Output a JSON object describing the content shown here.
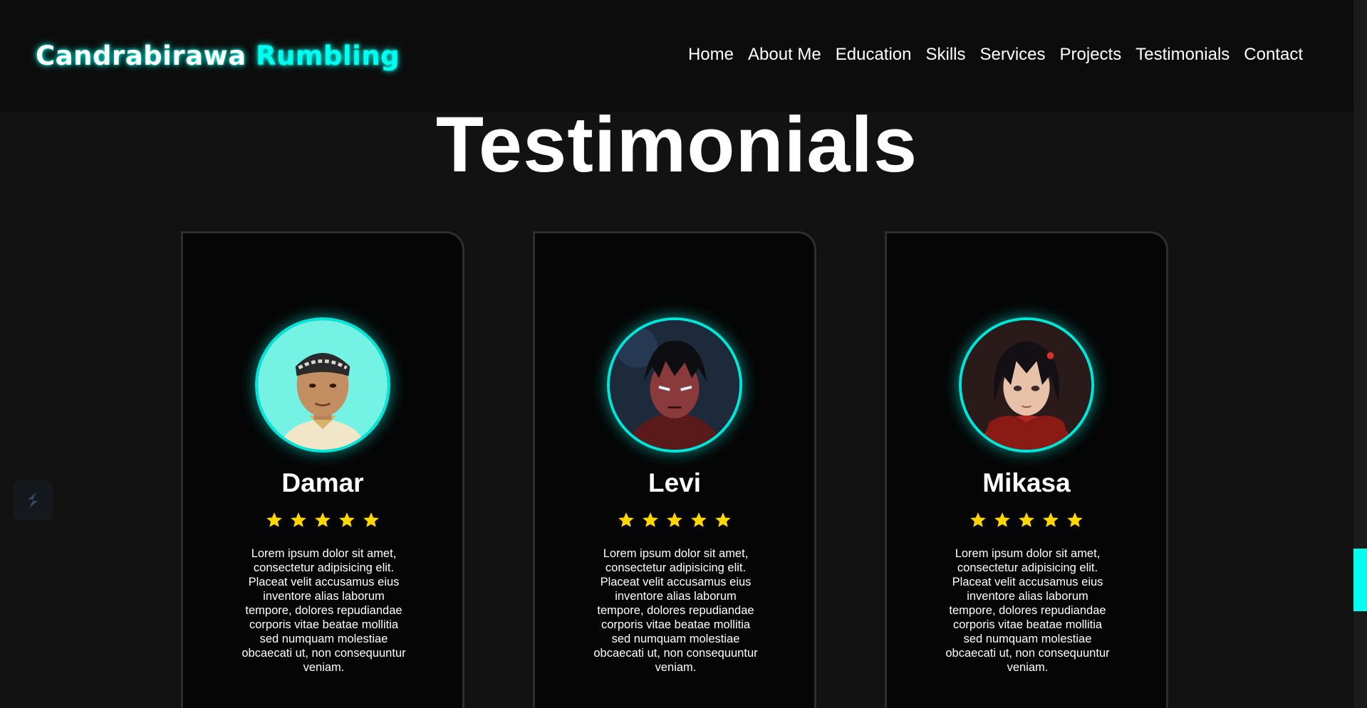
{
  "header": {
    "logo_main": "Candrabirawa",
    "logo_accent": "Rumbling",
    "nav": [
      "Home",
      "About Me",
      "Education",
      "Skills",
      "Services",
      "Projects",
      "Testimonials",
      "Contact"
    ]
  },
  "section": {
    "title": "Testimonials"
  },
  "testimonials": [
    {
      "name": "Damar",
      "rating": 5,
      "text": "Lorem ipsum dolor sit amet, consectetur adipisicing elit. Placeat velit accusamus eius inventore alias laborum tempore, dolores repudiandae corporis vitae beatae mollitia sed numquam molestiae obcaecati ut, non consequuntur veniam."
    },
    {
      "name": "Levi",
      "rating": 5,
      "text": "Lorem ipsum dolor sit amet, consectetur adipisicing elit. Placeat velit accusamus eius inventore alias laborum tempore, dolores repudiandae corporis vitae beatae mollitia sed numquam molestiae obcaecati ut, non consequuntur veniam."
    },
    {
      "name": "Mikasa",
      "rating": 5,
      "text": "Lorem ipsum dolor sit amet, consectetur adipisicing elit. Placeat velit accusamus eius inventore alias laborum tempore, dolores repudiandae corporis vitae beatae mollitia sed numquam molestiae obcaecati ut, non consequuntur veniam."
    }
  ],
  "colors": {
    "accent": "#00fff0",
    "star": "#ffd700",
    "background": "#121212"
  },
  "icons": {
    "widget": "s-logo-icon",
    "rating": "star-icon"
  }
}
